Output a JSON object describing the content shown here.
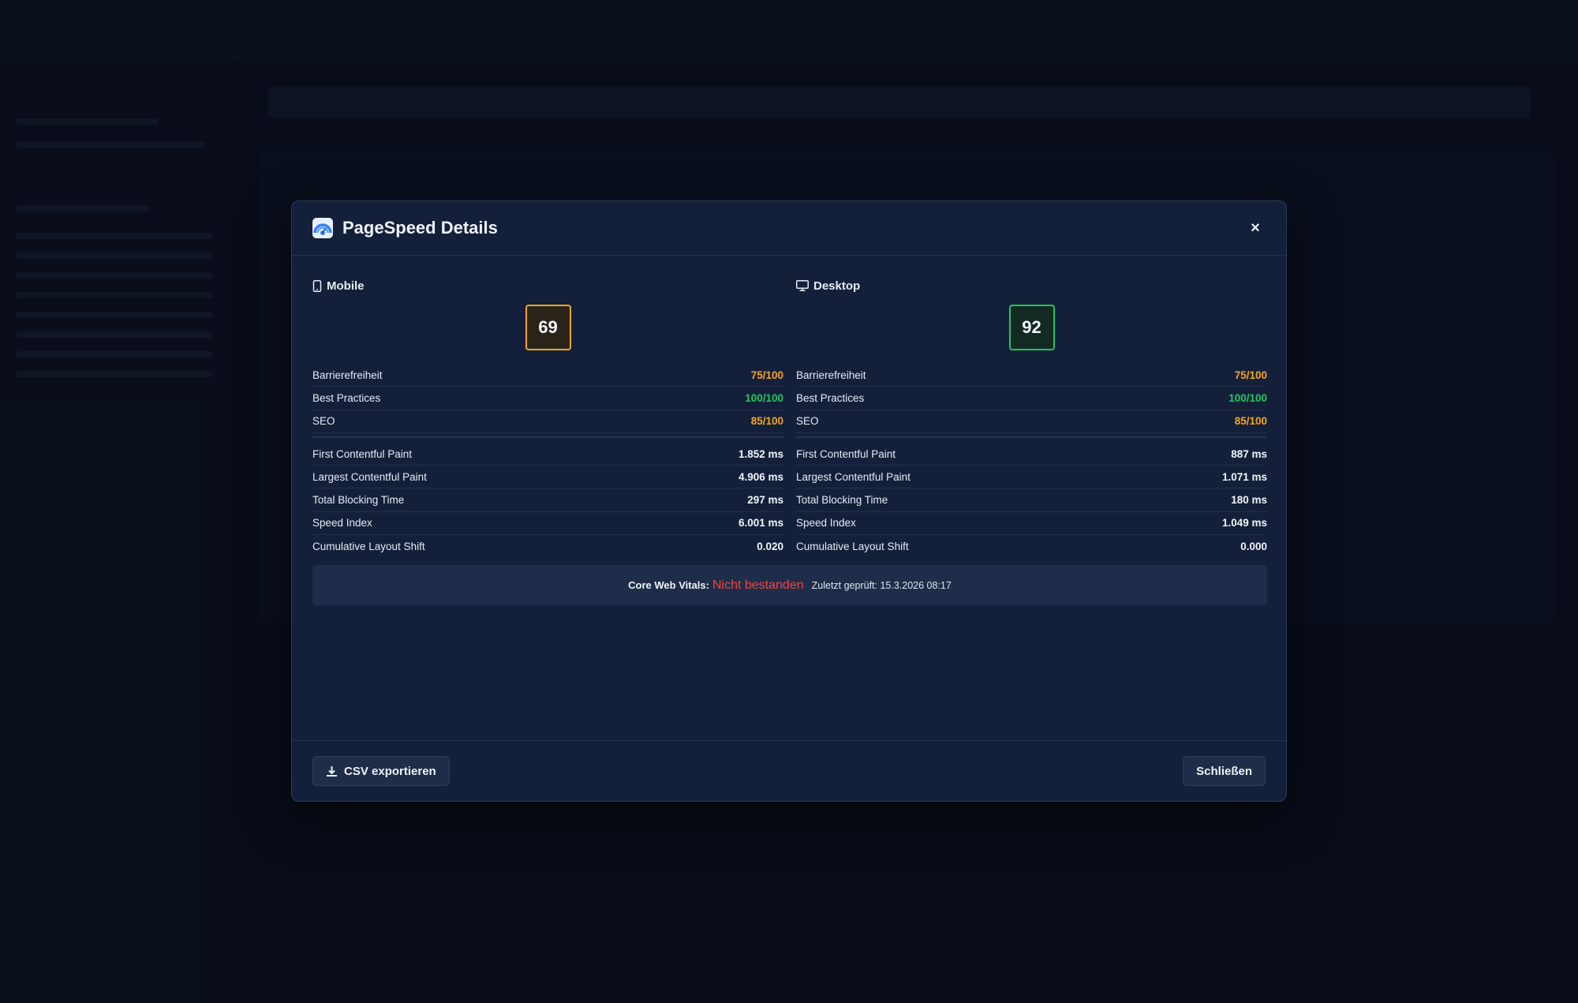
{
  "modal": {
    "title": "PageSpeed Details",
    "close_label": "×"
  },
  "mobile": {
    "label": "Mobile",
    "score": "69",
    "categories": [
      {
        "name": "Barrierefreiheit",
        "value": "75/100",
        "color": "#f5a524"
      },
      {
        "name": "Best Practices",
        "value": "100/100",
        "color": "#22c55e"
      },
      {
        "name": "SEO",
        "value": "85/100",
        "color": "#f5a524"
      }
    ],
    "metrics": [
      {
        "name": "First Contentful Paint",
        "value": "1.852 ms"
      },
      {
        "name": "Largest Contentful Paint",
        "value": "4.906 ms"
      },
      {
        "name": "Total Blocking Time",
        "value": "297 ms"
      },
      {
        "name": "Speed Index",
        "value": "6.001 ms"
      },
      {
        "name": "Cumulative Layout Shift",
        "value": "0.020"
      }
    ]
  },
  "desktop": {
    "label": "Desktop",
    "score": "92",
    "categories": [
      {
        "name": "Barrierefreiheit",
        "value": "75/100",
        "color": "#f5a524"
      },
      {
        "name": "Best Practices",
        "value": "100/100",
        "color": "#22c55e"
      },
      {
        "name": "SEO",
        "value": "85/100",
        "color": "#f5a524"
      }
    ],
    "metrics": [
      {
        "name": "First Contentful Paint",
        "value": "887 ms"
      },
      {
        "name": "Largest Contentful Paint",
        "value": "1.071 ms"
      },
      {
        "name": "Total Blocking Time",
        "value": "180 ms"
      },
      {
        "name": "Speed Index",
        "value": "1.049 ms"
      },
      {
        "name": "Cumulative Layout Shift",
        "value": "0.000"
      }
    ]
  },
  "core_web_vitals": {
    "label": "Core Web Vitals:",
    "status": "Nicht bestanden",
    "status_color": "#ef4444",
    "last_checked": "Zuletzt geprüft: 15.3.2026 08:17"
  },
  "footer": {
    "export_label": "CSV exportieren",
    "close_label": "Schließen"
  },
  "colors": {
    "score_orange": "#f5a524",
    "score_green": "#22c55e"
  },
  "icons": {
    "logo": "pagespeed-logo",
    "mobile": "mobile-phone-icon",
    "desktop": "desktop-monitor-icon",
    "close": "close-icon",
    "download": "download-icon"
  }
}
